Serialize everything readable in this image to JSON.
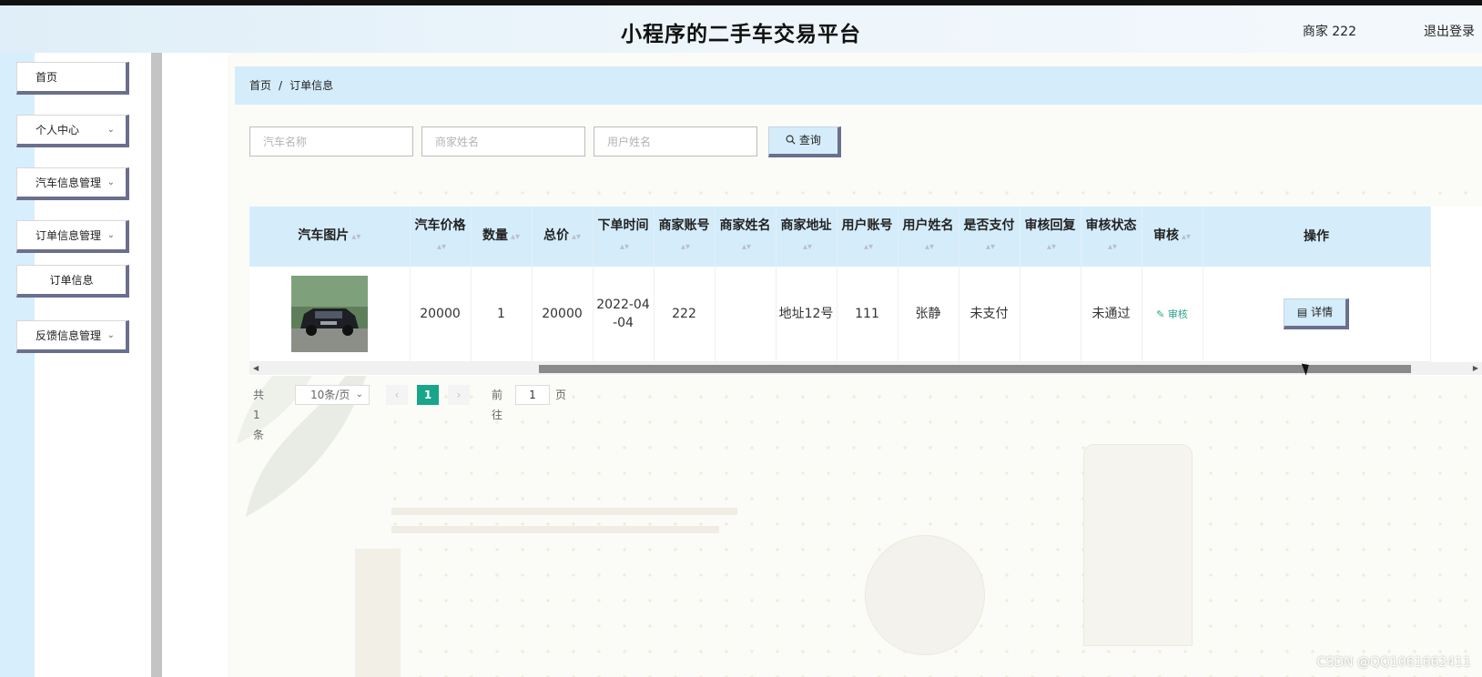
{
  "header": {
    "title": "小程序的二手车交易平台",
    "user": "商家 222",
    "logout": "退出登录"
  },
  "sidebar": {
    "items": [
      {
        "label": "首页"
      },
      {
        "label": "个人中心"
      },
      {
        "label": "汽车信息管理"
      },
      {
        "label": "订单信息管理"
      },
      {
        "label": "订单信息"
      },
      {
        "label": "反馈信息管理"
      }
    ]
  },
  "breadcrumb": {
    "home": "首页",
    "separator": "/",
    "current": "订单信息"
  },
  "search": {
    "car_name_placeholder": "汽车名称",
    "merchant_name_placeholder": "商家姓名",
    "user_name_placeholder": "用户姓名",
    "query_label": "查询"
  },
  "table": {
    "headers": {
      "car_image": "汽车图片",
      "car_price": "汽车价格",
      "quantity": "数量",
      "total_price": "总价",
      "order_time": "下单时间",
      "merchant_account": "商家账号",
      "merchant_name": "商家姓名",
      "merchant_address": "商家地址",
      "user_account": "用户账号",
      "user_name": "用户姓名",
      "is_paid": "是否支付",
      "audit_reply": "审核回复",
      "audit_status": "审核状态",
      "audit": "审核",
      "actions": "操作"
    },
    "rows": [
      {
        "car_price": "20000",
        "quantity": "1",
        "total_price": "20000",
        "order_time": "2022-04-04",
        "merchant_account": "222",
        "merchant_name": "",
        "merchant_address": "地址12号",
        "user_account": "111",
        "user_name": "张静",
        "is_paid": "未支付",
        "audit_reply": "",
        "audit_status": "未通过",
        "audit_link": "审核",
        "detail_label": "详情"
      }
    ]
  },
  "pagination": {
    "total": "共 1 条",
    "page_size": "10条/页",
    "current_page": "1",
    "goto_label": "前往",
    "goto_value": "1",
    "page_suffix": "页"
  },
  "watermark": "CSDN @QQ1061662411",
  "colors": {
    "accent": "#d5edfb",
    "button_shadow": "#6b6f8e",
    "pager_active": "#18a58a"
  }
}
